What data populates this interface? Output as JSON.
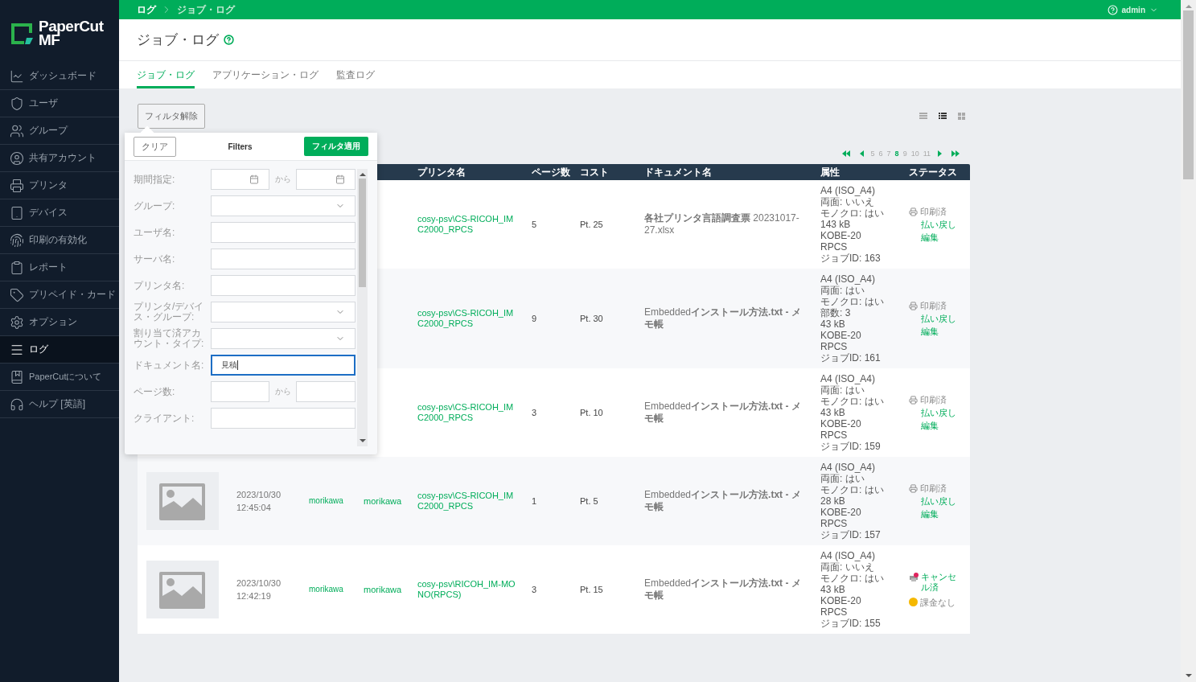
{
  "brand": {
    "name": "PaperCut",
    "product": "MF"
  },
  "sidebar": {
    "items": [
      {
        "label": "ダッシュボード",
        "selected": false
      },
      {
        "label": "ユーザ",
        "selected": false
      },
      {
        "label": "グループ",
        "selected": false
      },
      {
        "label": "共有アカウント",
        "selected": false
      },
      {
        "label": "プリンタ",
        "selected": false
      },
      {
        "label": "デバイス",
        "selected": false
      },
      {
        "label": "印刷の有効化",
        "selected": false
      },
      {
        "label": "レポート",
        "selected": false
      },
      {
        "label": "プリペイド・カード",
        "selected": false
      },
      {
        "label": "オプション",
        "selected": false
      },
      {
        "label": "ログ",
        "selected": true
      },
      {
        "label": "PaperCutについて",
        "selected": false
      },
      {
        "label": "ヘルプ [英語]",
        "selected": false
      }
    ]
  },
  "breadcrumb": [
    "ログ",
    "ジョブ・ログ"
  ],
  "user_menu": {
    "label": "admin"
  },
  "page_title": "ジョブ・ログ",
  "tabs": [
    {
      "label": "ジョブ・ログ",
      "selected": true
    },
    {
      "label": "アプリケーション・ログ",
      "selected": false
    },
    {
      "label": "監査ログ",
      "selected": false
    }
  ],
  "clear_filter_button": "フィルタ解除",
  "view_modes": [
    {
      "kind": "compact",
      "selected": false
    },
    {
      "kind": "list",
      "selected": true
    },
    {
      "kind": "grid",
      "selected": false
    }
  ],
  "pagination": [
    {
      "label": "5",
      "selected": false
    },
    {
      "label": "6",
      "selected": false
    },
    {
      "label": "7",
      "selected": false
    },
    {
      "label": "8",
      "selected": true
    },
    {
      "label": "9",
      "selected": false
    },
    {
      "label": "10",
      "selected": false
    },
    {
      "label": "11",
      "selected": false
    }
  ],
  "filter_popup": {
    "clear_button": "クリア",
    "title": "Filters",
    "apply_button": "フィルタ適用",
    "fields": [
      {
        "label": "期間指定:",
        "kind": "date-range",
        "separator": "から",
        "focused": false
      },
      {
        "label": "グループ:",
        "kind": "select",
        "focused": false
      },
      {
        "label": "ユーザ名:",
        "kind": "text",
        "focused": false
      },
      {
        "label": "サーバ名:",
        "kind": "text",
        "focused": false
      },
      {
        "label": "プリンタ名:",
        "kind": "text",
        "focused": false
      },
      {
        "label": "プリンタ/デバイス・グループ:",
        "kind": "select",
        "focused": false
      },
      {
        "label": "割り当て済アカウント・タイプ:",
        "kind": "select",
        "focused": false
      },
      {
        "label": "ドキュメント名:",
        "kind": "text",
        "value": "見積",
        "focused": true
      },
      {
        "label": "ページ数:",
        "kind": "number-range",
        "separator": "から",
        "focused": false
      },
      {
        "label": "クライアント:",
        "kind": "text",
        "focused": false
      }
    ]
  },
  "table": {
    "columns": [
      "",
      "",
      "",
      "",
      "プリンタ名",
      "ページ数",
      "コスト",
      "ドキュメント名",
      "属性",
      "ステータス"
    ],
    "rows": [
      {
        "printer": "cosy-psv\\CS-RICOH_IMC2000_RPCS",
        "pages": "5",
        "cost": "Pt. 25",
        "document": "**各社プリンタ言語調査票** 20231017-27.xlsx",
        "attributes": [
          "A4 (ISO_A4)",
          "両面: いいえ",
          "モノクロ: はい",
          "143 kB",
          "KOBE-20",
          "RPCS",
          "ジョブID: 163"
        ],
        "status": {
          "kind": "printed",
          "label": "印刷済",
          "actions": [
            "払い戻し",
            "編集"
          ]
        }
      },
      {
        "printer": "cosy-psv\\CS-RICOH_IMC2000_RPCS",
        "pages": "9",
        "cost": "Pt. 30",
        "document": "Embedded**インストール方法.txt - メモ帳**",
        "attributes": [
          "A4 (ISO_A4)",
          "両面: はい",
          "モノクロ: はい",
          "部数: 3",
          "43 kB",
          "KOBE-20",
          "RPCS",
          "ジョブID: 161"
        ],
        "status": {
          "kind": "printed",
          "label": "印刷済",
          "actions": [
            "払い戻し",
            "編集"
          ]
        }
      },
      {
        "printer": "cosy-psv\\CS-RICOH_IMC2000_RPCS",
        "pages": "3",
        "cost": "Pt. 10",
        "document": "Embedded**インストール方法.txt - メモ帳**",
        "attributes": [
          "A4 (ISO_A4)",
          "両面: はい",
          "モノクロ: はい",
          "43 kB",
          "KOBE-20",
          "RPCS",
          "ジョブID: 159"
        ],
        "status": {
          "kind": "printed",
          "label": "印刷済",
          "actions": [
            "払い戻し",
            "編集"
          ]
        }
      },
      {
        "thumbnail": {
          "kind": "picture"
        },
        "date": "2023/10/30",
        "time": "12:45:04",
        "user": "morikawa",
        "account": "morikawa",
        "printer": "cosy-psv\\CS-RICOH_IMC2000_RPCS",
        "pages": "1",
        "cost": "Pt. 5",
        "document": "Embedded**インストール方法.txt - メモ帳**",
        "attributes": [
          "A4 (ISO_A4)",
          "両面: はい",
          "モノクロ: はい",
          "28 kB",
          "KOBE-20",
          "RPCS",
          "ジョブID: 157"
        ],
        "status": {
          "kind": "printed",
          "label": "印刷済",
          "actions": [
            "払い戻し",
            "編集"
          ]
        }
      },
      {
        "thumbnail": {
          "kind": "picture"
        },
        "date": "2023/10/30",
        "time": "12:42:19",
        "user": "morikawa",
        "account": "morikawa",
        "printer": "cosy-psv\\RICOH_IM-MONO(RPCS)",
        "pages": "3",
        "cost": "Pt. 15",
        "document": "Embedded**インストール方法.txt - メモ帳**",
        "attributes": [
          "A4 (ISO_A4)",
          "両面: いいえ",
          "モノクロ: はい",
          "43 kB",
          "KOBE-20",
          "RPCS",
          "ジョブID: 155"
        ],
        "status": {
          "kind": "cancelled",
          "label": "キャンセル済",
          "note": "課金なし"
        }
      }
    ]
  }
}
